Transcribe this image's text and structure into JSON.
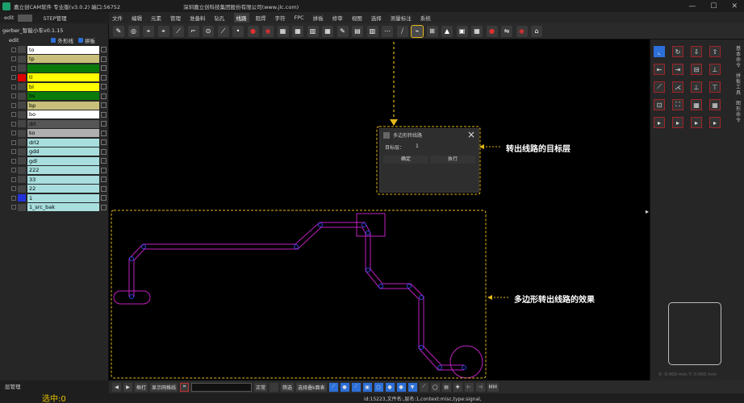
{
  "window": {
    "title": "嘉立创CAM软件 专业版(v3.0.2) 端口:56752",
    "company": "深圳嘉立创科技集团股份有限公司(www.jlc.com)",
    "controls": [
      "—",
      "☐",
      "✕"
    ]
  },
  "menu": [
    "文件",
    "编辑",
    "元素",
    "管理",
    "准备料",
    "钻孔",
    "线路",
    "阻焊",
    "字符",
    "FPC",
    "拼板",
    "修审",
    "视图",
    "选择",
    "测量标注",
    "系统"
  ],
  "menu_active": "线路",
  "left_panel": {
    "tabs": [
      "edit",
      "STEP管理"
    ],
    "project": "gerber_智能小车v0.1.15",
    "edit_label": "edit",
    "outline_label": "外形线",
    "panel_label": "拼板",
    "layers": [
      {
        "name": "to",
        "color": "#ffffff",
        "swatch": ""
      },
      {
        "name": "tp",
        "color": "#c8c07a",
        "swatch": ""
      },
      {
        "name": "",
        "color": "#0a7a0a",
        "swatch": ""
      },
      {
        "name": "tl",
        "color": "#ffff00",
        "swatch": "#dd0000"
      },
      {
        "name": "bl",
        "color": "#ffff00",
        "swatch": ""
      },
      {
        "name": "bs",
        "color": "#0a7a0a",
        "swatch": ""
      },
      {
        "name": "bp",
        "color": "#c8c07a",
        "swatch": ""
      },
      {
        "name": "bo",
        "color": "#ffffff",
        "swatch": ""
      },
      {
        "name": "drl",
        "color": "#555555",
        "swatch": ""
      },
      {
        "name": "ko",
        "color": "#b0b0b0",
        "swatch": ""
      },
      {
        "name": "drl2",
        "color": "#a8dede",
        "swatch": ""
      },
      {
        "name": "gdd",
        "color": "#a8dede",
        "swatch": ""
      },
      {
        "name": "gdl",
        "color": "#a8dede",
        "swatch": ""
      },
      {
        "name": "222",
        "color": "#a8dede",
        "swatch": ""
      },
      {
        "name": "33",
        "color": "#a8dede",
        "swatch": ""
      },
      {
        "name": "22",
        "color": "#a8dede",
        "swatch": ""
      },
      {
        "name": "1",
        "color": "#a8dede",
        "swatch": "#2233dd"
      },
      {
        "name": "1_src_bak",
        "color": "#a8dede",
        "swatch": ""
      }
    ],
    "footer_tab": "层管理",
    "selected": "选中:0"
  },
  "dialog": {
    "title": "多边形转线路",
    "target_label": "目标层：",
    "target_value": "1",
    "ok": "确定",
    "run": "执行"
  },
  "annotations": {
    "target_layer": "转出线路的目标层",
    "effect": "多边形转出线路的效果"
  },
  "bottom": {
    "buttons": [
      "◀",
      "▶",
      "框打",
      "显示网格线",
      "",
      "",
      "正常",
      "",
      "筛选",
      "选择叠k面表"
    ],
    "unit": "MM"
  },
  "status": "id:15223,文件名:,层名:1,context:misc,type:signal,",
  "right_panel": {
    "side_labels": [
      "基本命令",
      "拼板工具",
      "图形命令"
    ],
    "coords": "X: 0.000 mm   Y: 0.000 mm"
  },
  "colors": {
    "accent": "#e5b818",
    "trace_outline": "#c020c0",
    "trace_vertex": "#2a46e0"
  }
}
